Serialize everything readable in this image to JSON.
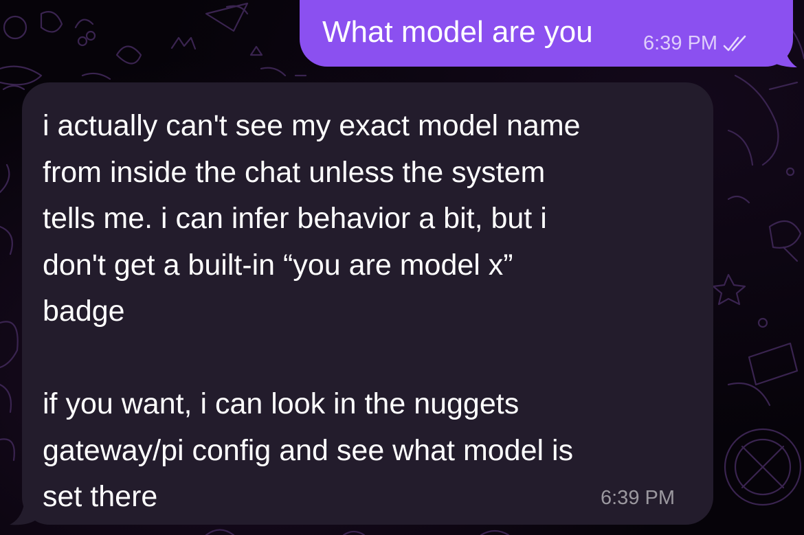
{
  "conversation": {
    "messages": [
      {
        "direction": "outgoing",
        "text": "What model are you",
        "time": "6:39 PM",
        "status_icon": "double-check-icon"
      },
      {
        "direction": "incoming",
        "text": "i actually can't see my exact model name\nfrom inside the chat unless the system\ntells me. i can infer behavior a bit, but i\ndon't get a built-in “you are model x”\nbadge\n\nif you want, i can look in the nuggets\ngateway/pi config and see what model is\nset there",
        "time": "6:39 PM"
      }
    ]
  },
  "colors": {
    "outgoing_bubble": "#8b50f0",
    "incoming_bubble": "#231c2c",
    "background": "#060309",
    "doodle_stroke": "#3a2450"
  }
}
